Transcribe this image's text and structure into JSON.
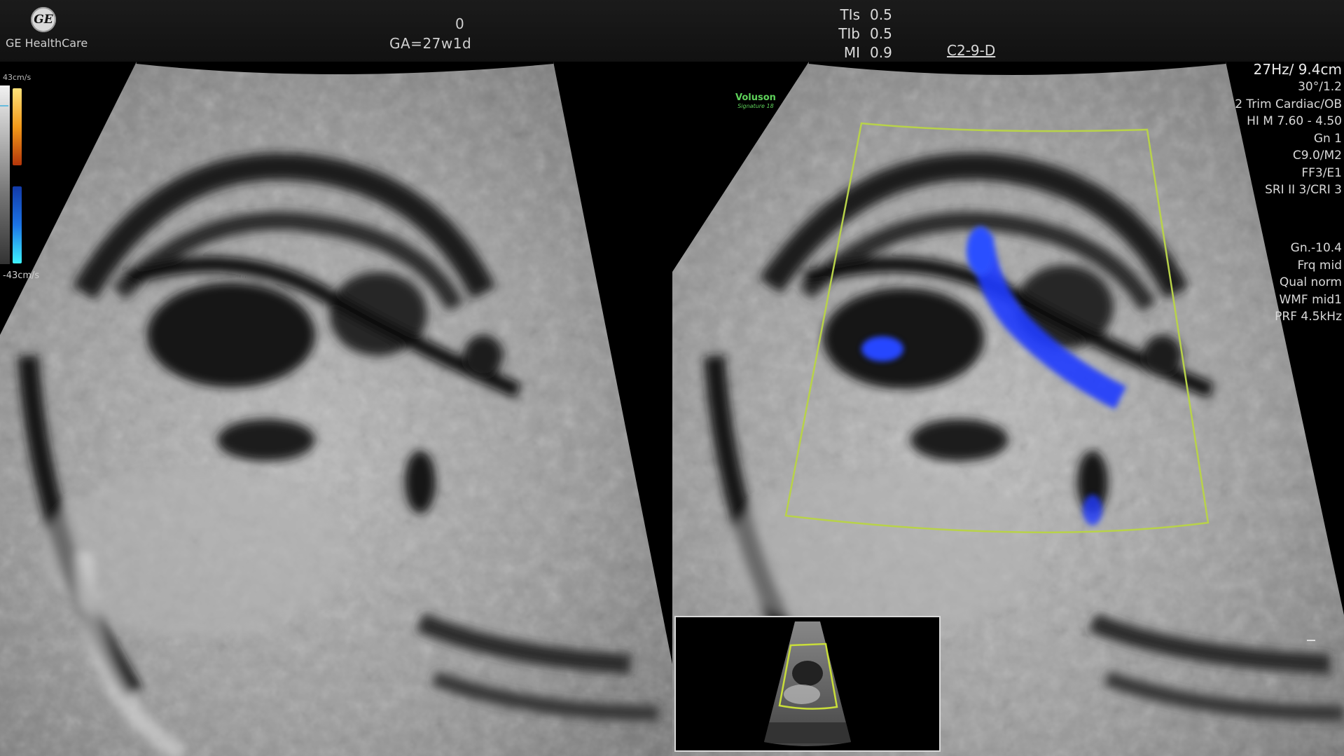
{
  "header": {
    "brand_logo_text": "GE",
    "brand_name": "GE HealthCare",
    "depth_marker": "0",
    "gestational_age": "GA=27w1d",
    "safety_indices": [
      {
        "label": "TIs",
        "value": "0.5"
      },
      {
        "label": "TIb",
        "value": "0.5"
      },
      {
        "label": "MI",
        "value": "0.9"
      }
    ],
    "probe": "C2-9-D"
  },
  "color_scale": {
    "top_label": "43cm/s",
    "bottom_label": "-43cm/s",
    "colors": {
      "positive": "#f39a1a",
      "negative": "#1c74e6"
    }
  },
  "right_panel": {
    "logo_name": "Voluson",
    "logo_sub": "Signature 18",
    "params_top": [
      "27Hz/ 9.4cm",
      "30°/1.2",
      "2 Trim Cardiac/OB",
      "HI M  7.60 - 4.50",
      "Gn  1",
      "C9.0/M2",
      "FF3/E1",
      "SRI II 3/CRI 3"
    ],
    "params_color": [
      "Gn.-10.4",
      "Frq mid",
      "Qual norm",
      "WMF mid1",
      "PRF 4.5kHz"
    ]
  },
  "colors": {
    "roi_box": "#b8d24a",
    "doppler_flow": "#1f3cff"
  }
}
